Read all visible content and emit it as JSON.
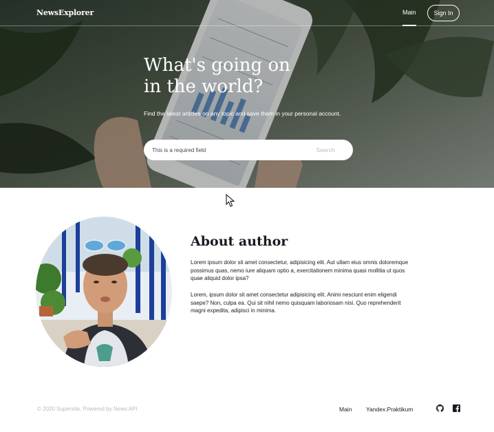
{
  "header": {
    "logo": "NewsExplorer",
    "nav_main": "Main",
    "sign_in": "Sign In"
  },
  "hero": {
    "title_line1": "What's going on",
    "title_line2": "in the world?",
    "subtitle": "Find the latest articles on any topic and save them in your personal account.",
    "search_placeholder": "This is a required field",
    "search_button": "Search"
  },
  "about": {
    "title": "About author",
    "paragraph1": "Lorem ipsum dolor sit amet consectetur, adipisicing elit. Aut ullam eius omnis doloremque possimus quas, nemo iure aliquam optio a, exercitationem minima quasi mollitia ut quos quae aliquid dolor ipsa?",
    "paragraph2": "Lorem, ipsum dolor sit amet consectetur adipisicing elit. Animi nesciunt enim eligendi saepe? Non, culpa ea. Qui sit nihil nemo quisquam laboriosam nisi. Quo reprehenderit magni expedita, adipisci in minima."
  },
  "footer": {
    "copyright": "© 2020 Supersite, Powered by News API",
    "link_main": "Main",
    "link_yandex": "Yandex.Praktikum",
    "icons": [
      "github-icon",
      "facebook-icon"
    ]
  },
  "colors": {
    "text_primary": "#1a1b22",
    "muted": "#b6bcbf",
    "white": "#ffffff"
  }
}
